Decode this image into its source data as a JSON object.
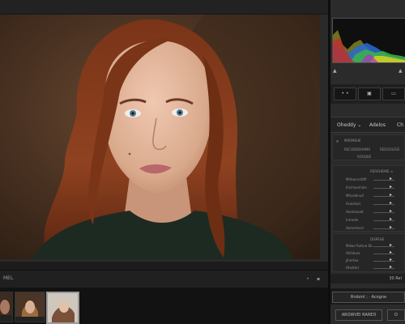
{
  "statusbar": {
    "left_label": "MEL"
  },
  "right_panel": {
    "tool_buttons": [
      "• •",
      "▣",
      "▭"
    ],
    "tabs": [
      "Oheddy ⌄",
      "Adelos",
      "Ch"
    ],
    "section1": {
      "rows": [
        "MRRMEHE",
        "RECODDEHHMA",
        "ROOQKE"
      ],
      "value_label": "REDOOLFEE"
    },
    "section2": {
      "header": "RERRHEMIE ≡",
      "sliders": [
        {
          "label": "Mhhwcvsttffi",
          "value": 0.85
        },
        {
          "label": "Imchoenhole",
          "value": 0.85
        },
        {
          "label": "Mhcedinud",
          "value": 0.85
        },
        {
          "label": "Acwdsed",
          "value": 0.85
        },
        {
          "label": "Aoelsseoet",
          "value": 0.85
        },
        {
          "label": "Inmede",
          "value": 0.85
        },
        {
          "label": "Aommtecd",
          "value": 0.85
        }
      ]
    },
    "section3": {
      "header": "DISPEHE",
      "sliders": [
        {
          "label": "Mdwe Ruttue Eb",
          "value": 0.85
        },
        {
          "label": "Ahihbuie",
          "value": 0.85
        },
        {
          "label": "Jihnrtoe",
          "value": 0.85
        },
        {
          "label": "Hhaitter",
          "value": 0.85
        }
      ]
    },
    "footer_status": "30 Rel",
    "actions": [
      "Rrsbml ; · Acogne",
      "AROWVEI RARED",
      "D"
    ]
  },
  "filmstrip": {
    "count": 4,
    "selected_index": 3
  }
}
